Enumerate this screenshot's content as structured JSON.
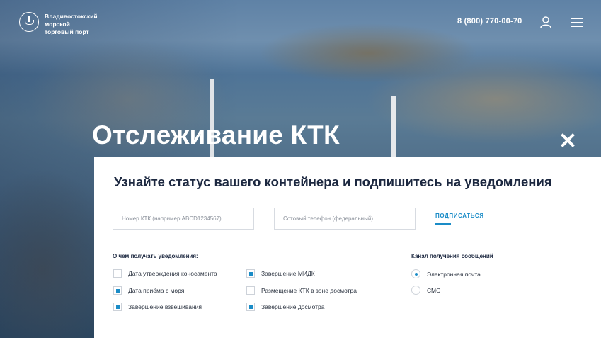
{
  "header": {
    "logo_line1": "Владивостокский",
    "logo_line2": "морской",
    "logo_line3": "торговый порт",
    "phone": "8 (800) 770-00-70"
  },
  "page_title": "Отслеживание КТК",
  "panel": {
    "subtitle": "Узнайте статус вашего контейнера и подпишитесь на уведомления",
    "ktk_placeholder": "Номер КТК (например ABCD1234567)",
    "phone_placeholder": "Сотовый телефон (федеральный)",
    "subscribe_label": "ПОДПИСАТЬСЯ",
    "notifications_label": "О чем получать уведомления:",
    "notifications_col1": [
      {
        "label": "Дата утверждения коносамента",
        "checked": false
      },
      {
        "label": "Дата приёма с моря",
        "checked": true
      },
      {
        "label": "Завершение взвешивания",
        "checked": true
      }
    ],
    "notifications_col2": [
      {
        "label": "Завершение МИДК",
        "checked": true
      },
      {
        "label": "Размещение КТК в зоне досмотра",
        "checked": false
      },
      {
        "label": "Завершение досмотра",
        "checked": true
      }
    ],
    "channel_label": "Канал получения сообщений",
    "channels": [
      {
        "label": "Электронная почта",
        "selected": true
      },
      {
        "label": "СМС",
        "selected": false
      }
    ]
  },
  "colors": {
    "accent": "#1a8cc7",
    "heading": "#1c2840"
  },
  "icons": {
    "user": "user-icon",
    "menu": "hamburger-menu-icon",
    "close": "close-icon",
    "logo": "port-emblem-icon"
  }
}
